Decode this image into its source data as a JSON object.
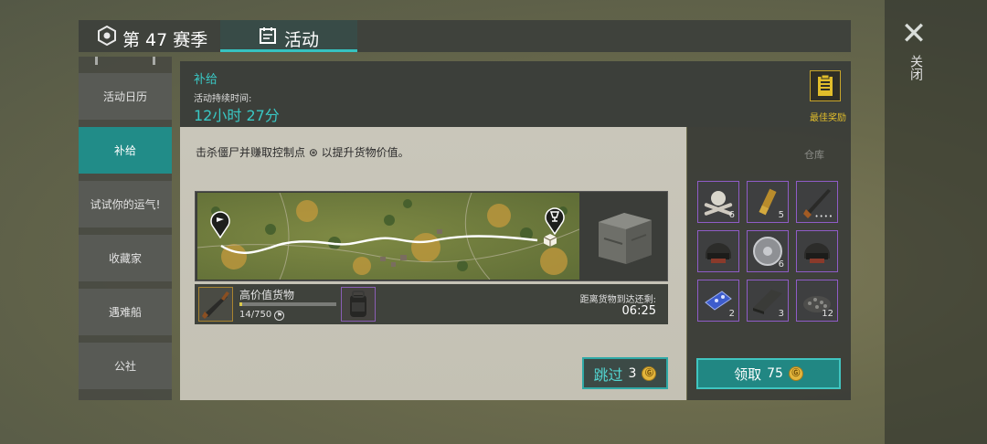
{
  "window": {
    "close_label": "关闭"
  },
  "tabs": [
    {
      "label": "第 47 赛季"
    },
    {
      "label": "活动"
    }
  ],
  "sidebar": {
    "items": [
      {
        "label": "活动日历"
      },
      {
        "label": "补给"
      },
      {
        "label": "试试你的运气!"
      },
      {
        "label": "收藏家"
      },
      {
        "label": "遇难船"
      },
      {
        "label": "公社"
      }
    ]
  },
  "header": {
    "title": "补给",
    "duration_label": "活动持续时间:",
    "duration_value": "12小时 27分",
    "best_reward_label": "最佳奖励"
  },
  "main": {
    "description": "击杀僵尸并赚取控制点 ⊛ 以提升货物价值。",
    "cargo_name": "高价值货物",
    "progress_text": "14/750",
    "progress_fraction": 0.019,
    "arrive_label": "距离货物到达还剩:",
    "arrive_time": "06:25",
    "skip_label": "跳过",
    "skip_cost": "3"
  },
  "warehouse": {
    "label": "仓库",
    "items": [
      {
        "icon": "skull-bones-icon",
        "qty": "6"
      },
      {
        "icon": "shotgun-shell-icon",
        "qty": "5"
      },
      {
        "icon": "rifle-icon",
        "qty": "••••"
      },
      {
        "icon": "helmet-icon",
        "qty": ""
      },
      {
        "icon": "pan-lid-icon",
        "qty": "6"
      },
      {
        "icon": "tactical-helmet-icon",
        "qty": ""
      },
      {
        "icon": "blue-circuit-icon",
        "qty": "2"
      },
      {
        "icon": "metal-sheet-icon",
        "qty": "3"
      },
      {
        "icon": "gravel-pile-icon",
        "qty": "12"
      }
    ],
    "claim_label": "领取",
    "claim_cost": "75"
  },
  "colors": {
    "accent": "#36c3c0",
    "gold": "#e1bd2b",
    "rare_border": "#8f5cc7"
  }
}
